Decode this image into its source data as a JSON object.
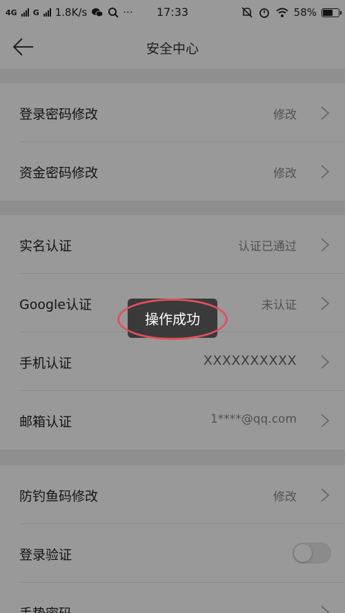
{
  "status_bar": {
    "net1": "4G",
    "net2": "G",
    "speed": "1.8K/s",
    "dots": "···",
    "time": "17:33",
    "battery": "58%",
    "battery_level": 0.58
  },
  "header": {
    "title": "安全中心"
  },
  "sections": [
    {
      "rows": [
        {
          "label": "登录密码修改",
          "value": "修改"
        },
        {
          "label": "资金密码修改",
          "value": "修改"
        }
      ]
    },
    {
      "rows": [
        {
          "label": "实名认证",
          "value": "认证已通过"
        },
        {
          "label": "Google认证",
          "value": "未认证"
        },
        {
          "label": "手机认证",
          "value": "XXXXXXXXXX"
        },
        {
          "label": "邮箱认证",
          "value": "1****@qq.com"
        }
      ]
    },
    {
      "rows": [
        {
          "label": "防钓鱼码修改",
          "value": "修改"
        },
        {
          "label": "登录验证",
          "toggle": false
        },
        {
          "label": "手势密码"
        }
      ]
    }
  ],
  "toast": {
    "text": "操作成功"
  },
  "colors": {
    "highlight": "#e0505a",
    "overlay": "rgba(0,0,0,0.4)"
  }
}
